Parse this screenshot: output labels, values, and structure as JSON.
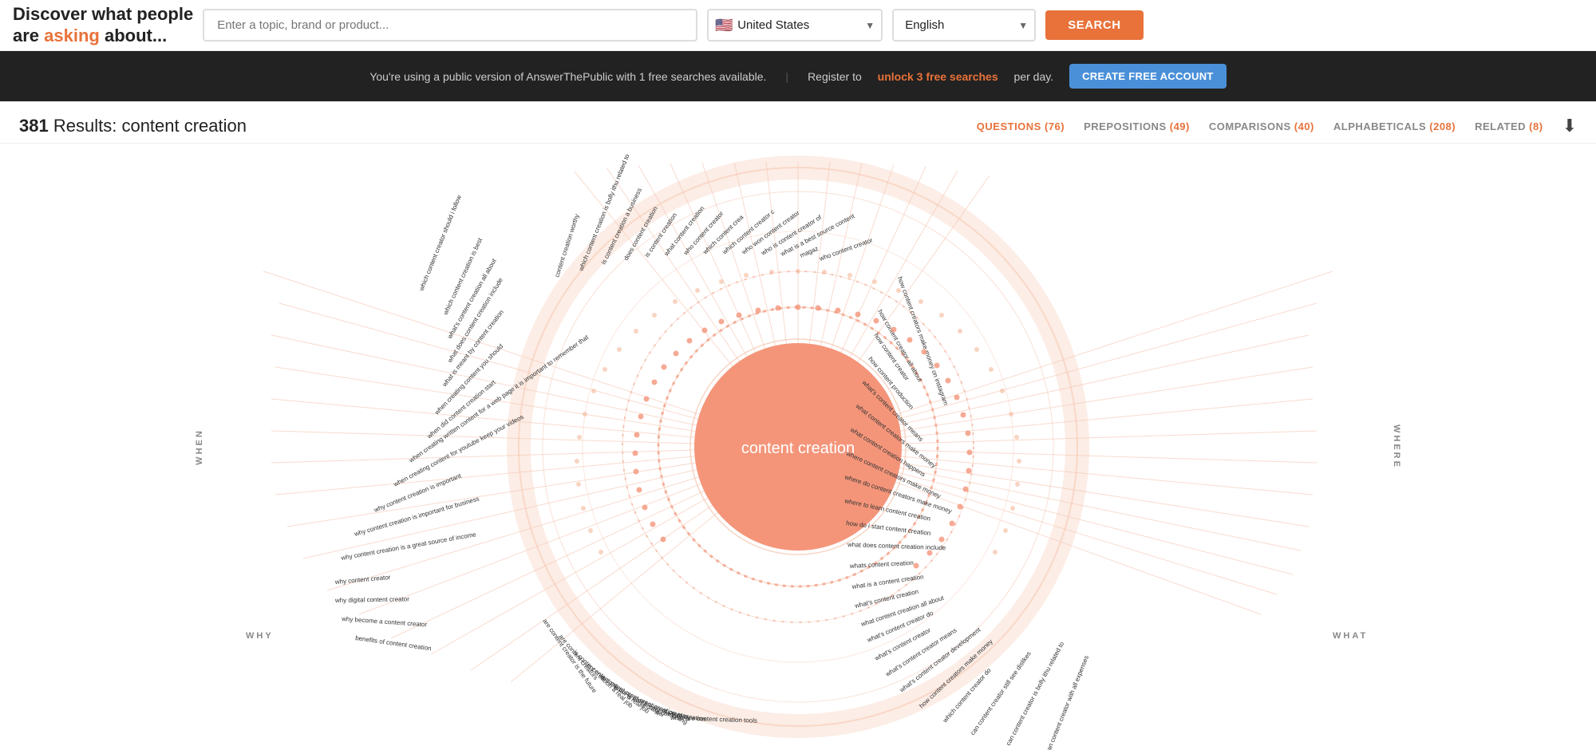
{
  "header": {
    "logo_line1": "Discover what people",
    "logo_line2_prefix": "are ",
    "logo_asking": "asking",
    "logo_line2_suffix": " about...",
    "search_placeholder": "Enter a topic, brand or product...",
    "country_value": "United States",
    "country_flag": "🇺🇸",
    "language_value": "English",
    "search_button": "SEARCH"
  },
  "notice": {
    "text1": "You're using a public version of AnswerThePublic with 1 free searches available.",
    "text2": "Register to",
    "link_text": "unlock 3 free searches",
    "text3": "per day.",
    "cta_button": "CREATE FREE ACCOUNT"
  },
  "results": {
    "count": "381",
    "label": "Results:",
    "query": "content creation",
    "tabs": [
      {
        "label": "QUESTIONS",
        "count": "76",
        "active": true
      },
      {
        "label": "PREPOSITIONS",
        "count": "49",
        "active": false
      },
      {
        "label": "COMPARISONS",
        "count": "40",
        "active": false
      },
      {
        "label": "ALPHABETICALS",
        "count": "208",
        "active": false
      },
      {
        "label": "RELATED",
        "count": "8",
        "active": false
      }
    ]
  },
  "wheel": {
    "center_label": "content creation",
    "center_color": "#f4957a",
    "ring_color": "#f4c4b0",
    "spoke_color": "#f4c4b0",
    "side_labels": {
      "left": "WHEN",
      "right": "WHERE",
      "bottom_left": "WHY",
      "bottom_right": "WHAT"
    },
    "when_items": [
      "which content creator should i follow",
      "which content creation is best",
      "what's content creation all about",
      "what does content creation include",
      "what is meant by content creation",
      "when creating content you should",
      "when did content creation start",
      "when creating written content for a web page it is important to remember that",
      "when creating content for youtube keep your videos",
      "why content creation is important",
      "why content creation is important for business",
      "why content creation is a great source of income",
      "why content creator",
      "why digital content creator",
      "why become a content creator",
      "benefits of content creation"
    ],
    "where_items": [
      "how content creators make money",
      "how content creation all about",
      "how content creator",
      "how content production",
      "what's content creator means",
      "what content creators make money",
      "what content creation happens",
      "where content creators make money",
      "where do content creators make money",
      "where to learn content creation",
      "how do i start content creation",
      "what does content creation include",
      "whats content creation",
      "what is a content creation",
      "what's content creation",
      "what content creation all about",
      "what's content creator do",
      "what's content creator",
      "what's content creator means",
      "what's content creator development",
      "how content creators make money",
      "which content creator do",
      "can content creator still see dislikes",
      "can content creator is bolly ithu related to",
      "can content creator with all expenses"
    ],
    "why_items": [
      "are content creator is the future",
      "are content creators",
      "is content creation a real job",
      "is content creator a real job",
      "is content creator a career",
      "is content creation marketing",
      "is content creation tools",
      "is content creator",
      "is content creation",
      "what are content creation tools"
    ],
    "what_items": [
      "who content creator",
      "who content crea",
      "who won content creator c",
      "who is content creator of",
      "what is a best source content con",
      "magaz",
      "who content creator"
    ]
  }
}
